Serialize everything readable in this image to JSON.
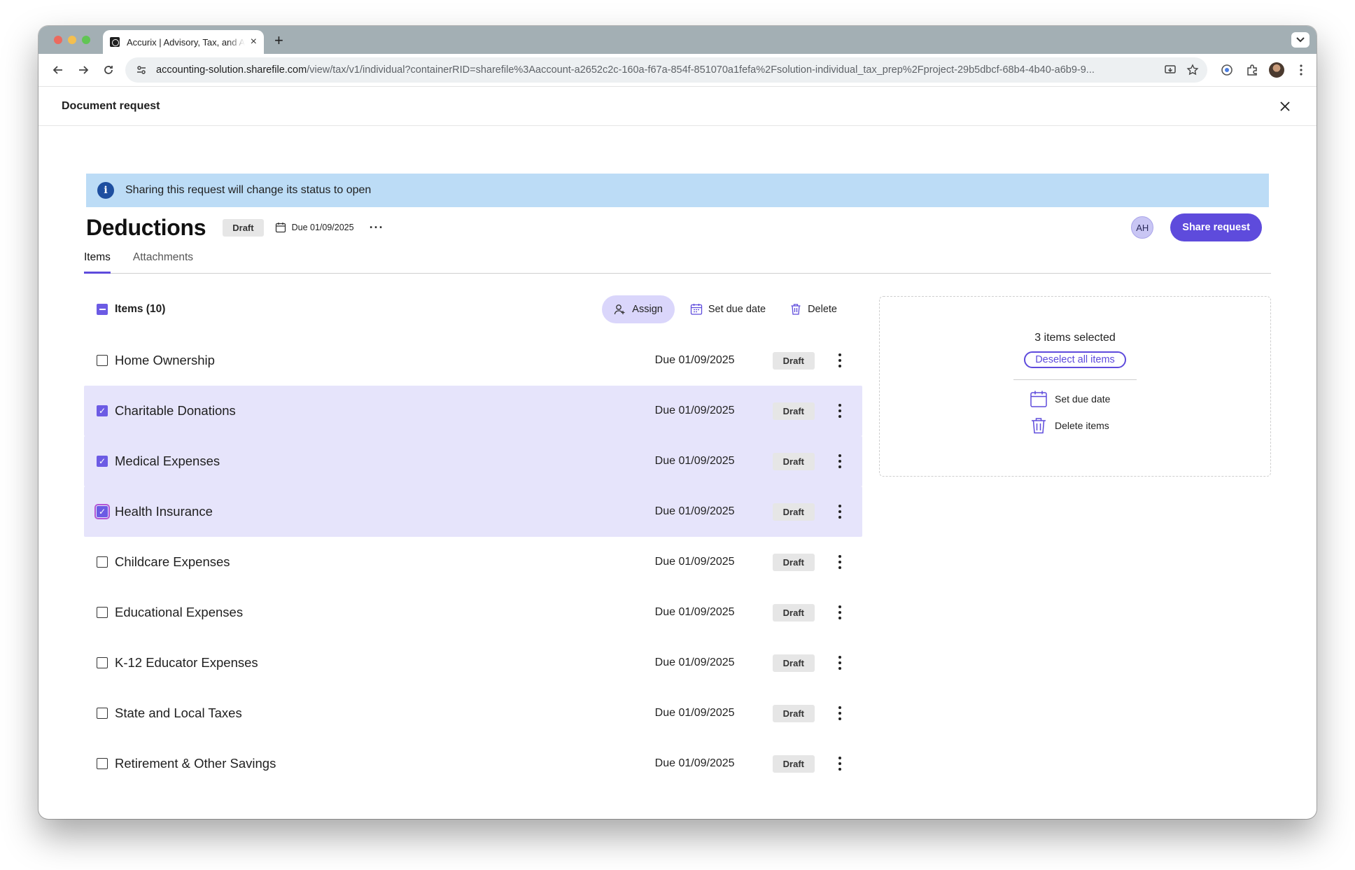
{
  "browser": {
    "tab_title": "Accurix | Advisory, Tax, and Accounting",
    "url_domain": "accounting-solution.sharefile.com",
    "url_path": "/view/tax/v1/individual?containerRID=sharefile%3Aaccount-a2652c2c-160a-f67a-854f-851070a1fefa%2Fsolution-individual_tax_prep%2Fproject-29b5dbcf-68b4-4b40-a6b9-9..."
  },
  "modal": {
    "title": "Document request"
  },
  "banner": {
    "text": "Sharing this request will change its status to open"
  },
  "request": {
    "title": "Deductions",
    "status": "Draft",
    "due": "Due 01/09/2025",
    "avatar_initials": "AH",
    "share_label": "Share request"
  },
  "tabs": [
    {
      "label": "Items",
      "active": true
    },
    {
      "label": "Attachments",
      "active": false
    }
  ],
  "list": {
    "header_label": "Items (10)",
    "assign_label": "Assign",
    "set_due_label": "Set due date",
    "delete_label": "Delete",
    "items": [
      {
        "label": "Home Ownership",
        "due": "Due 01/09/2025",
        "status": "Draft",
        "checked": false
      },
      {
        "label": "Charitable Donations",
        "due": "Due 01/09/2025",
        "status": "Draft",
        "checked": true
      },
      {
        "label": "Medical Expenses",
        "due": "Due 01/09/2025",
        "status": "Draft",
        "checked": true
      },
      {
        "label": "Health Insurance",
        "due": "Due 01/09/2025",
        "status": "Draft",
        "checked": true,
        "focused": true
      },
      {
        "label": "Childcare Expenses",
        "due": "Due 01/09/2025",
        "status": "Draft",
        "checked": false
      },
      {
        "label": "Educational Expenses",
        "due": "Due 01/09/2025",
        "status": "Draft",
        "checked": false
      },
      {
        "label": "K-12 Educator Expenses",
        "due": "Due 01/09/2025",
        "status": "Draft",
        "checked": false
      },
      {
        "label": "State and Local Taxes",
        "due": "Due 01/09/2025",
        "status": "Draft",
        "checked": false
      },
      {
        "label": "Retirement & Other Savings",
        "due": "Due 01/09/2025",
        "status": "Draft",
        "checked": false
      }
    ]
  },
  "side_panel": {
    "selected_text": "3 items selected",
    "deselect_label": "Deselect all items",
    "set_due_label": "Set due date",
    "delete_label": "Delete items"
  },
  "colors": {
    "accent": "#5e4bdc",
    "selected_row": "#e6e4fb",
    "banner": "#bcdcf6"
  }
}
